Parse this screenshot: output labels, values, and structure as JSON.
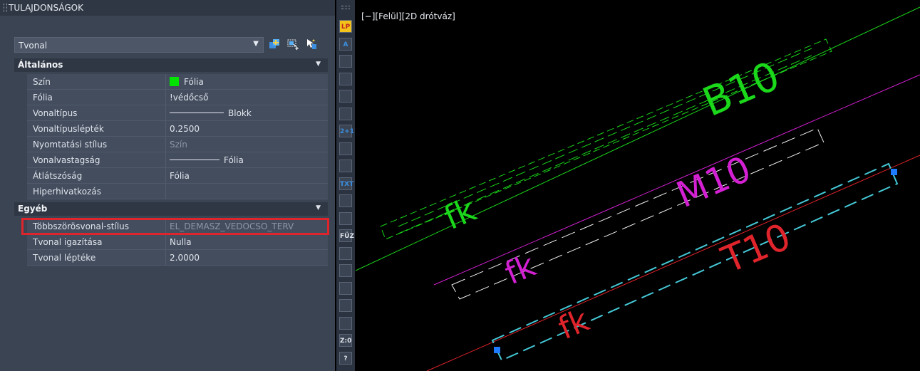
{
  "panel": {
    "title": "TULAJDONSÁGOK",
    "object_type": "Tvonal",
    "buttons": [
      "toggle-pickadd-icon",
      "select-objects-icon",
      "quick-select-icon"
    ]
  },
  "sections": {
    "general": {
      "title": "Általános",
      "rows": [
        {
          "label": "Szín",
          "value": "Fólia",
          "swatch": "#00e400"
        },
        {
          "label": "Fólia",
          "value": "!védőcső"
        },
        {
          "label": "Vonaltípus",
          "value": "Blokk"
        },
        {
          "label": "Vonaltípuslépték",
          "value": "0.2500"
        },
        {
          "label": "Nyomtatási stílus",
          "value": "Szín"
        },
        {
          "label": "Vonalvastagság",
          "value": "Fólia"
        },
        {
          "label": "Átlátszóság",
          "value": "Fólia"
        },
        {
          "label": "Hiperhivatkozás",
          "value": ""
        }
      ]
    },
    "other": {
      "title": "Egyéb",
      "rows": [
        {
          "label": "Többszörösvonal-stílus",
          "value": "EL_DEMASZ_VEDOCSO_TERV"
        },
        {
          "label": "Tvonal igazítása",
          "value": "Nulla"
        },
        {
          "label": "Tvonal léptéke",
          "value": "2.0000"
        }
      ]
    }
  },
  "toolbar": {
    "items": [
      {
        "name": "lp-icon",
        "text": "LP"
      },
      {
        "name": "text-style-icon",
        "text": "A"
      },
      {
        "name": "frame-icon",
        "text": ""
      },
      {
        "name": "dimension-icon",
        "text": ""
      },
      {
        "name": "rotate-icon",
        "text": ""
      },
      {
        "name": "measure-icon",
        "text": ""
      },
      {
        "name": "sum-icon",
        "text": "2+1"
      },
      {
        "name": "snap-icon",
        "text": ""
      },
      {
        "name": "trace-icon",
        "text": ""
      },
      {
        "name": "txt-icon",
        "text": "TXT"
      },
      {
        "name": "list-icon",
        "text": ""
      },
      {
        "name": "fork-icon",
        "text": ""
      },
      {
        "name": "fuz-icon",
        "text": "FÜZ"
      },
      {
        "name": "convert-icon",
        "text": ""
      },
      {
        "name": "swap-icon",
        "text": ""
      },
      {
        "name": "triangle-icon",
        "text": ""
      },
      {
        "name": "profile-icon",
        "text": ""
      },
      {
        "name": "calc-icon",
        "text": ""
      },
      {
        "name": "z-icon",
        "text": "Z:0"
      },
      {
        "name": "help-icon",
        "text": "?"
      }
    ]
  },
  "viewport": {
    "label": "[−][Felül][2D drótváz]",
    "labels": {
      "b10": "B10",
      "fk_green": "fk",
      "m10": "M10",
      "fk_magenta": "fk",
      "t10": "T10",
      "fk_red": "fk"
    }
  },
  "colors": {
    "highlight": "#e0242c",
    "green": "#1bd81b",
    "magenta": "#d320d3",
    "red": "#e0242c",
    "cyan": "#45c8d6",
    "grip_blue": "#1e7bff"
  }
}
